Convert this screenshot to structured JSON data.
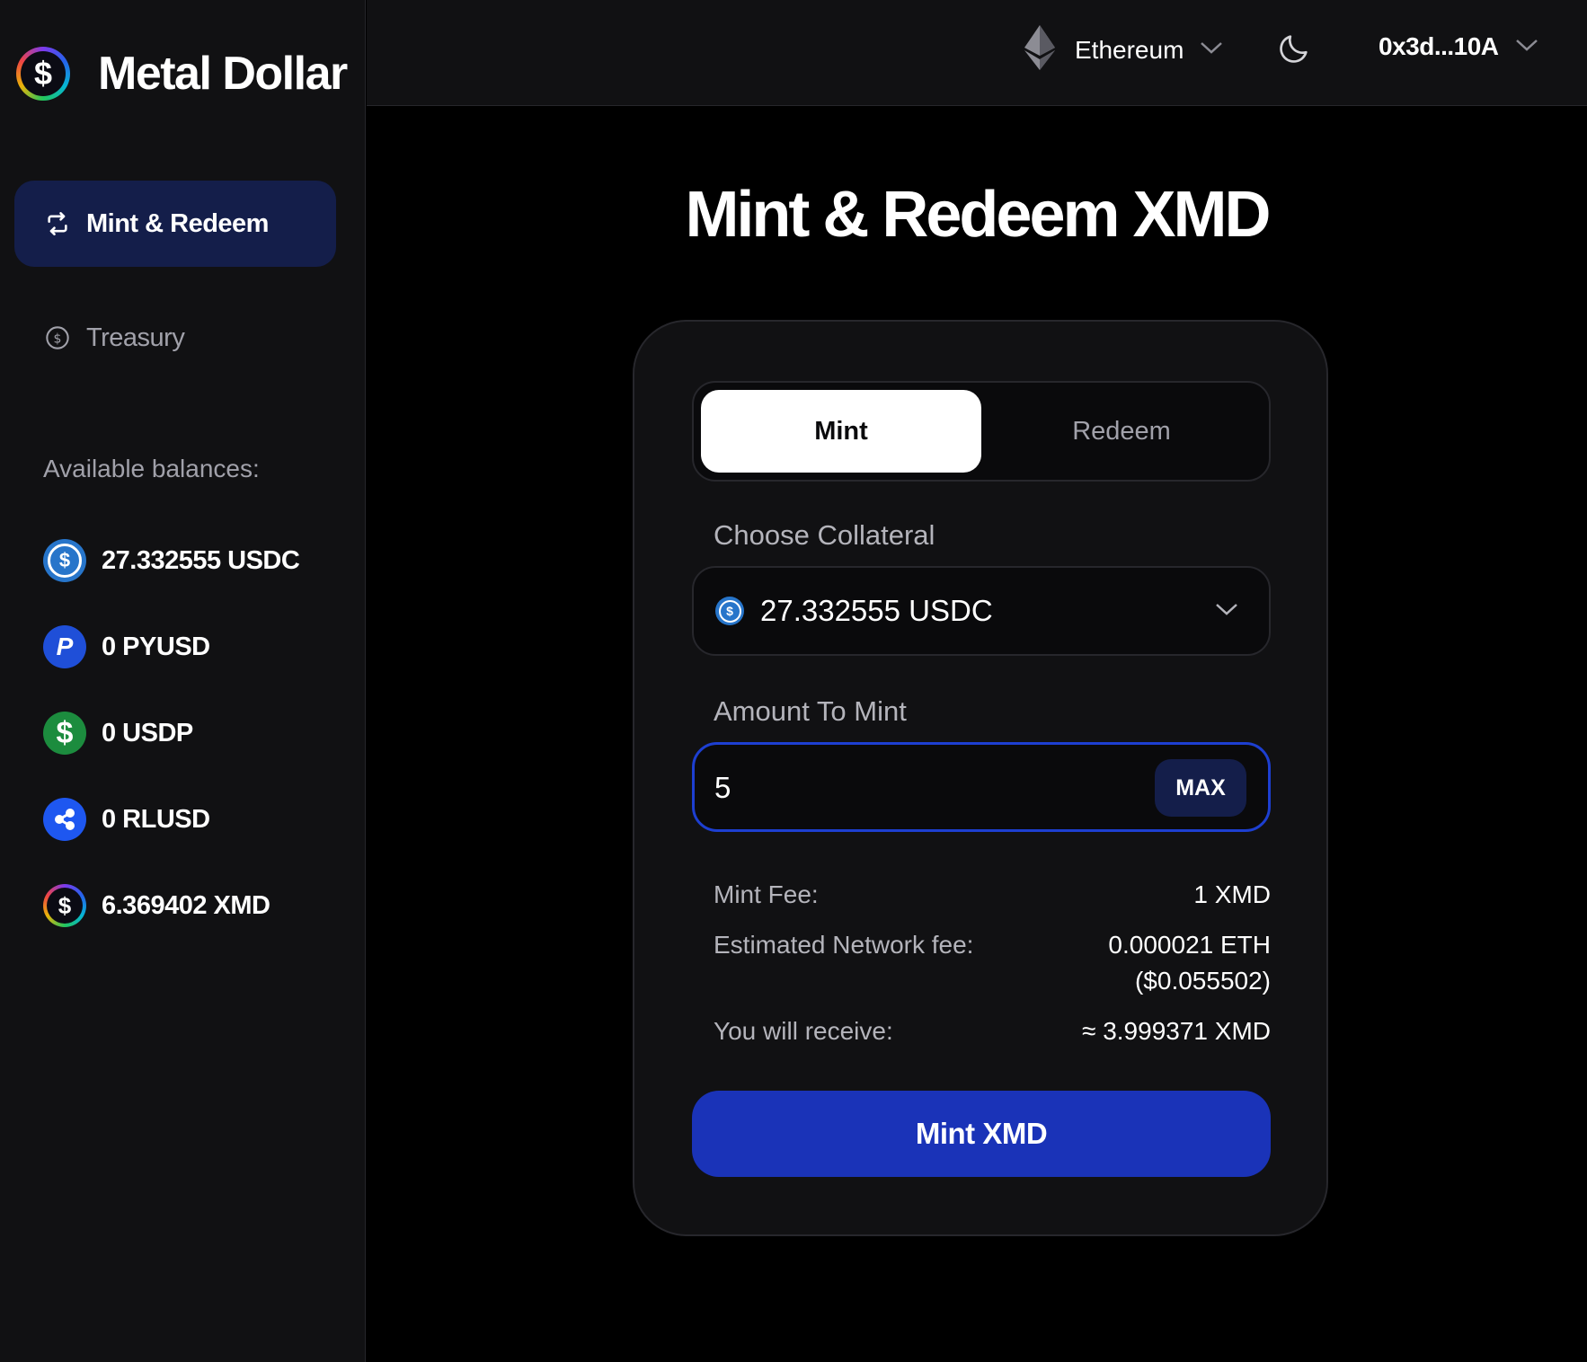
{
  "brand": {
    "name": "Metal Dollar",
    "logo_glyph": "$"
  },
  "sidebar": {
    "nav": [
      {
        "label": "Mint & Redeem",
        "icon": "swap-arrows-icon",
        "active": true
      },
      {
        "label": "Treasury",
        "icon": "dollar-circle-icon",
        "active": false
      }
    ],
    "balances_title": "Available balances:",
    "balances": [
      {
        "label": "27.332555 USDC",
        "icon": "usdc-icon",
        "glyph": "$"
      },
      {
        "label": "0 PYUSD",
        "icon": "pyusd-icon",
        "glyph": "P"
      },
      {
        "label": "0 USDP",
        "icon": "usdp-icon",
        "glyph": "$"
      },
      {
        "label": "0 RLUSD",
        "icon": "rlusd-icon",
        "glyph": ""
      },
      {
        "label": "6.369402 XMD",
        "icon": "xmd-icon",
        "glyph": "$"
      }
    ]
  },
  "header": {
    "network": {
      "label": "Ethereum",
      "icon": "ethereum-icon"
    },
    "theme_icon": "moon-icon",
    "wallet": {
      "label": "0x3d...10A"
    }
  },
  "main": {
    "title": "Mint & Redeem XMD",
    "tabs": [
      {
        "label": "Mint",
        "active": true
      },
      {
        "label": "Redeem",
        "active": false
      }
    ],
    "collateral_label": "Choose Collateral",
    "collateral_value": "27.332555 USDC",
    "amount_label": "Amount To Mint",
    "amount_value": "5",
    "max_label": "MAX",
    "info": {
      "mint_fee_label": "Mint Fee:",
      "mint_fee_value": "1 XMD",
      "network_fee_label": "Estimated Network fee:",
      "network_fee_value_line1": "0.000021 ETH",
      "network_fee_value_line2": "($0.055502)",
      "receive_label": "You will receive:",
      "receive_value": "≈ 3.999371 XMD"
    },
    "cta_label": "Mint XMD"
  },
  "colors": {
    "background": "#000000",
    "panel": "#111113",
    "accent": "#1a33b8",
    "accent_dark": "#141e4a",
    "input_border": "#1d3fd1"
  }
}
